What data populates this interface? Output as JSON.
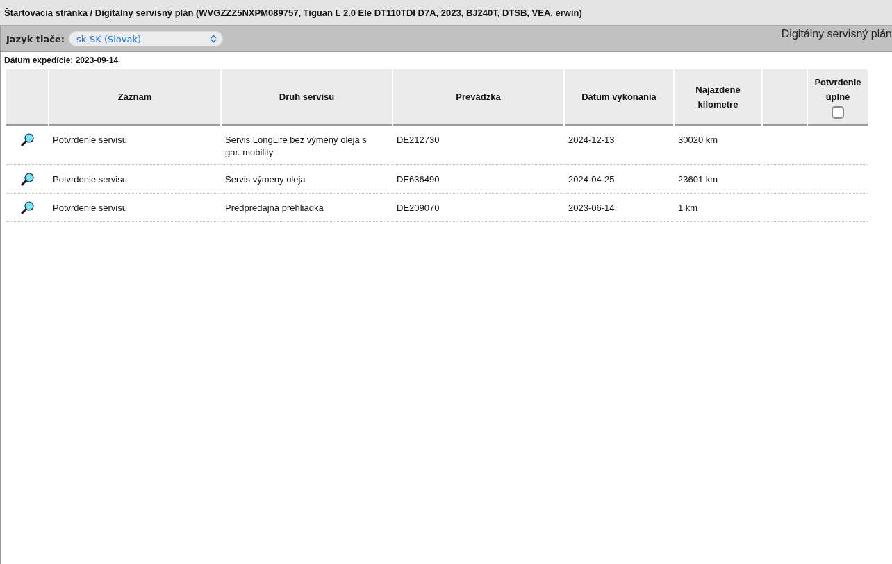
{
  "breadcrumb": "Štartovacia stránka / Digitálny servisný plán (WVGZZZ5NXPM089757, Tiguan L 2.0 Ele DT110TDI D7A, 2023, BJ240T, DTSB, VEA, erwin)",
  "toolbar": {
    "language_label": "Jazyk tlače:",
    "language_value": "sk-SK (Slovak)",
    "title": "Digitálny servisný plán"
  },
  "dispatch_date": "Dátum expedície: 2023-09-14",
  "table": {
    "columns": [
      {},
      {
        "label": "Záznam"
      },
      {
        "label": "Druh servisu"
      },
      {
        "label": "Prevádzka"
      },
      {
        "label": "Dátum vykonania"
      },
      {
        "label": "Najazdené kilometre"
      },
      {},
      {
        "label": "Potvrdenie úplné",
        "kind": "checkbox",
        "checked": false
      }
    ],
    "rows": [
      {
        "record": "Potvrdenie servisu",
        "service": "Servis LongLife bez výmeny oleja s gar. mobility",
        "dealer": "DE212730",
        "date": "2024-12-13",
        "mileage": "30020 km"
      },
      {
        "record": "Potvrdenie servisu",
        "service": "Servis výmeny oleja",
        "dealer": "DE636490",
        "date": "2024-04-25",
        "mileage": "23601 km"
      },
      {
        "record": "Potvrdenie servisu",
        "service": "Predpredajná prehliadka",
        "dealer": "DE209070",
        "date": "2023-06-14",
        "mileage": "1 km"
      }
    ]
  }
}
